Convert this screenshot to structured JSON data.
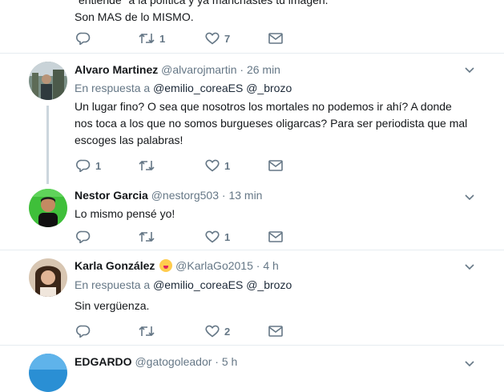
{
  "tweets": [
    {
      "text_lines": [
        "\"entiende\" a la política y ya manchastes tu imagen.",
        "Son MAS de lo MISMO."
      ],
      "actions": {
        "reply": "",
        "retweet": "1",
        "like": "7"
      }
    },
    {
      "name": "Alvaro Martinez",
      "handle": "@alvarojmartin",
      "time": "· 26 min",
      "reply_prefix": "En respuesta a",
      "mentions": "@emilio_coreaES @_brozo",
      "text": "Un lugar fino? O sea que nosotros los mortales no podemos ir ahí? A donde nos toca a los que no somos burgueses oligarcas? Para ser periodista que mal escoges las palabras!",
      "actions": {
        "reply": "1",
        "retweet": "",
        "like": "1"
      }
    },
    {
      "name": "Nestor Garcia",
      "handle": "@nestorg503",
      "time": "· 13 min",
      "text": "Lo mismo pensé yo!",
      "actions": {
        "reply": "",
        "retweet": "",
        "like": "1"
      }
    },
    {
      "name": "Karla González",
      "emoji": "winking-face-tongue",
      "handle": "@KarlaGo2015",
      "time": "· 4 h",
      "reply_prefix": "En respuesta a",
      "mentions": "@emilio_coreaES @_brozo",
      "text": "Sin vergüenza.",
      "actions": {
        "reply": "",
        "retweet": "",
        "like": "2"
      }
    },
    {
      "name": "EDGARDO",
      "handle": "@gatogoleador",
      "time": "· 5 h"
    }
  ],
  "colors": {
    "link": "#1c2938",
    "muted": "#657786",
    "border": "#e6ecf0"
  }
}
